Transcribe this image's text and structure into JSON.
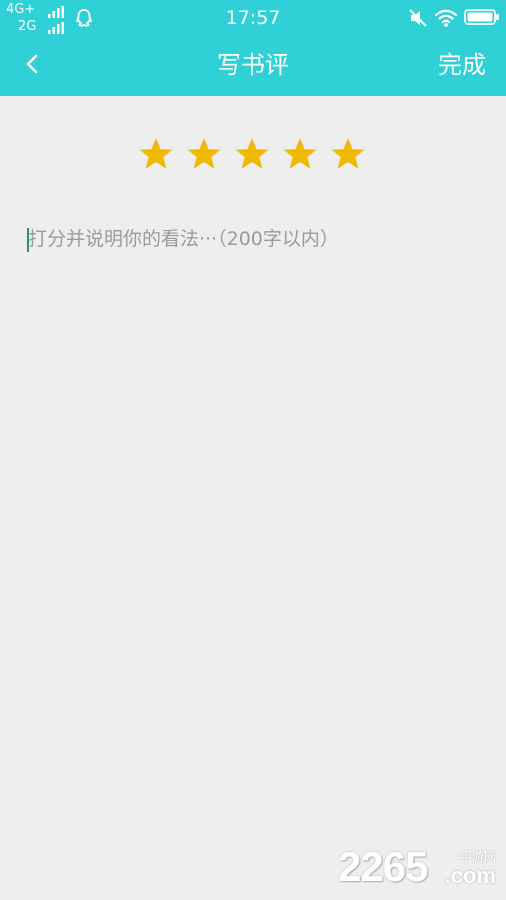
{
  "status_bar": {
    "network_top": "4G+",
    "network_bottom": "2G",
    "time": "17:57",
    "icons": [
      "signal-icon",
      "signal-icon",
      "qq-icon",
      "mute-icon",
      "wifi-icon",
      "battery-icon"
    ]
  },
  "header": {
    "title": "写书评",
    "done_label": "完成",
    "back_icon": "chevron-left-icon"
  },
  "rating": {
    "value": 5,
    "max": 5,
    "star_color": "#f1b800"
  },
  "review": {
    "placeholder": "打分并说明你的看法···（200字以内）",
    "value": ""
  },
  "watermark": {
    "number": "2265",
    "label_cn": "手游网",
    "label_com": ".com"
  },
  "colors": {
    "header_bg": "#2fd0d6",
    "page_bg": "#eeeeee",
    "placeholder": "#9b9b9b"
  }
}
